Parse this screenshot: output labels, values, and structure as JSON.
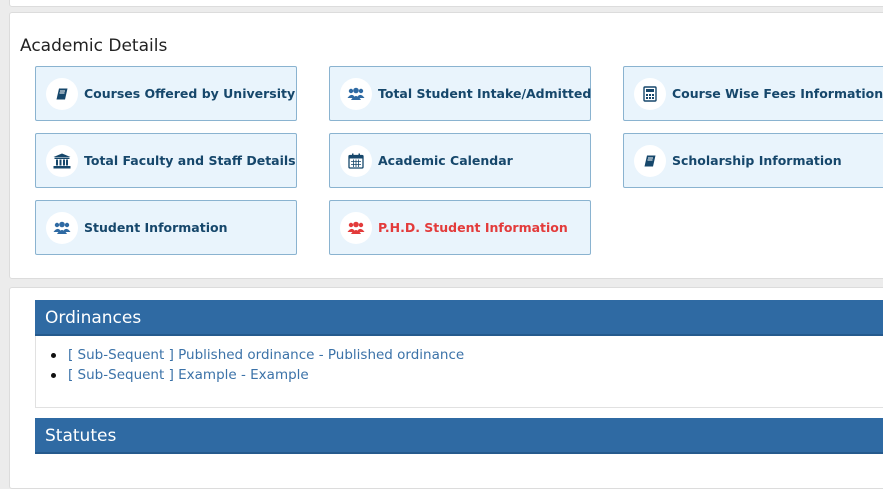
{
  "academic": {
    "title": "Academic Details",
    "tiles": [
      {
        "label": "Courses Offered by University",
        "icon": "book-icon"
      },
      {
        "label": "Total Student Intake/Admitted",
        "icon": "users-icon"
      },
      {
        "label": "Course Wise Fees Information",
        "icon": "calculator-icon"
      },
      {
        "label": "Total Faculty and Staff Details",
        "icon": "institution-icon"
      },
      {
        "label": "Academic Calendar",
        "icon": "calendar-icon"
      },
      {
        "label": "Scholarship Information",
        "icon": "book-icon"
      },
      {
        "label": "Student Information",
        "icon": "users-icon"
      },
      {
        "label": "P.H.D. Student Information",
        "icon": "users-icon",
        "highlight_color": "#e33b3b"
      }
    ]
  },
  "ordinances": {
    "title": "Ordinances",
    "items": [
      {
        "label": "[ Sub-Sequent ] Published ordinance - Published ordinance"
      },
      {
        "label": "[ Sub-Sequent ] Example - Example"
      }
    ]
  },
  "statutes": {
    "title": "Statutes"
  },
  "colors": {
    "header_blue": "#2f6aa3",
    "tile_bg": "#e9f4fc",
    "tile_text": "#16476b",
    "link": "#3b72a8",
    "alert_red": "#e33b3b"
  }
}
